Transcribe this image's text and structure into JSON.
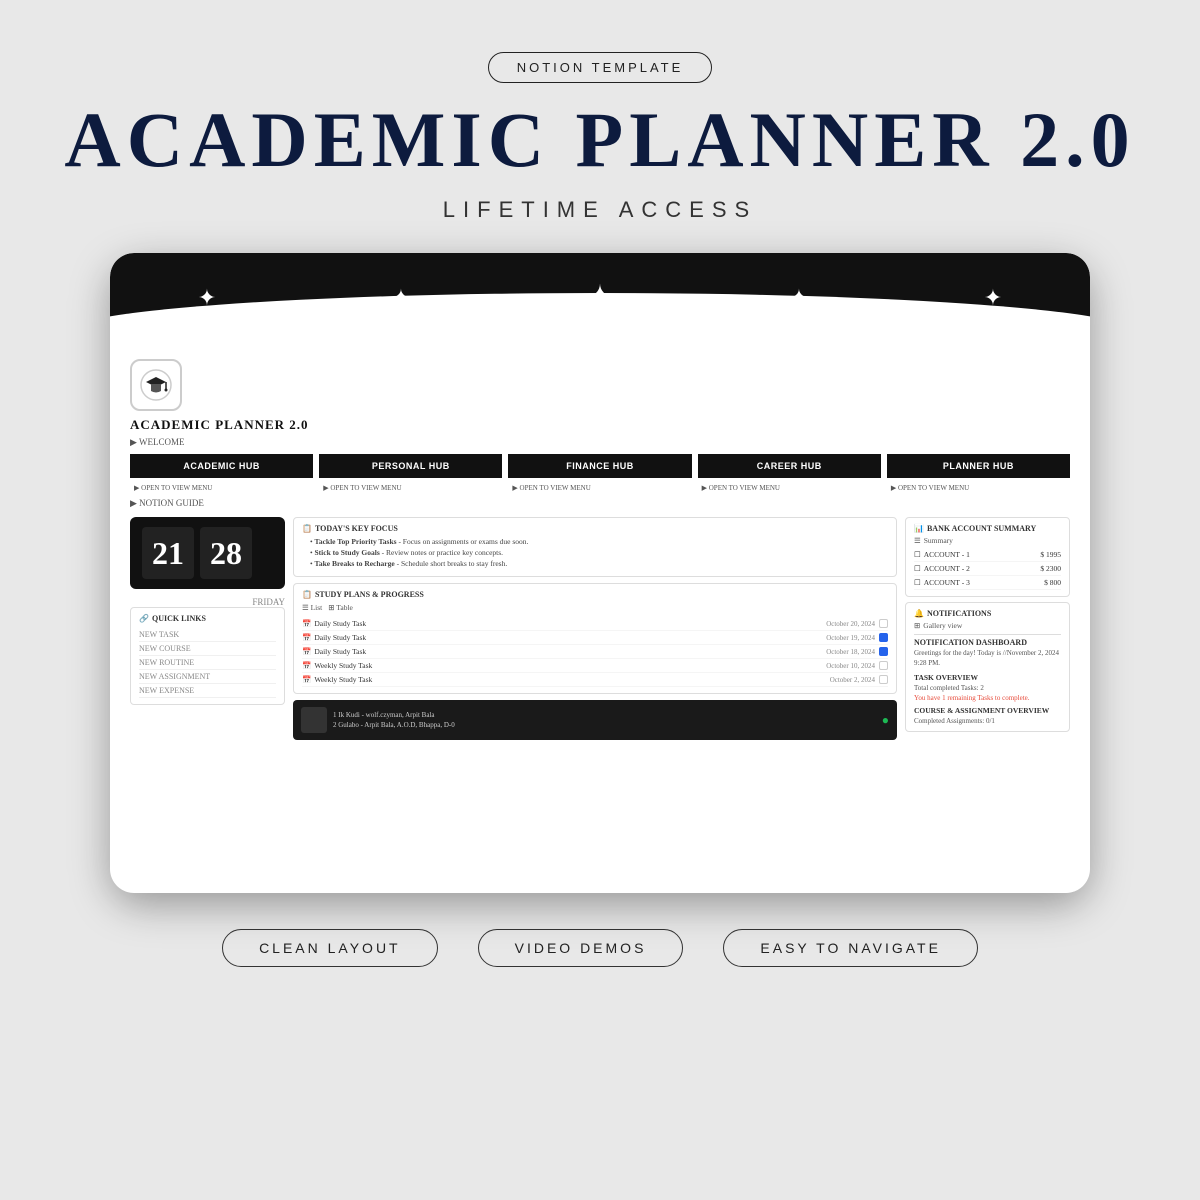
{
  "top_badge": "NOTION TEMPLATE",
  "main_title": "ACADEMIC PLANNER 2.0",
  "subtitle": "LIFETIME ACCESS",
  "device": {
    "stars": [
      "✦",
      "✦",
      "✦",
      "✦"
    ],
    "large_star": "✦",
    "notion_page_title": "ACADEMIC PLANNER 2.0",
    "welcome_label": "▶ WELCOME",
    "hub_buttons": [
      {
        "label": "ACADEMIC HUB"
      },
      {
        "label": "PERSONAL HUB"
      },
      {
        "label": "FINANCE HUB"
      },
      {
        "label": "CAREER HUB"
      },
      {
        "label": "PLANNER HUB"
      }
    ],
    "open_menu_label": "▶ OPEN TO VIEW MENU",
    "notion_guide_label": "▶ NOTION GUIDE",
    "clock": {
      "hour": "21",
      "minute": "28",
      "day": "FRIDAY"
    },
    "quick_links": {
      "title": "QUICK LINKS",
      "items": [
        "NEW TASK",
        "NEW COURSE",
        "NEW ROUTINE",
        "NEW ASSIGNMENT",
        "NEW EXPENSE"
      ]
    },
    "focus": {
      "title": "TODAY'S KEY FOCUS",
      "items": [
        {
          "bold": "Tackle Top Priority Tasks",
          "text": " - Focus on assignments or exams due soon."
        },
        {
          "bold": "Stick to Study Goals",
          "text": " - Review notes or practice key concepts."
        },
        {
          "bold": "Take Breaks to Recharge",
          "text": " - Schedule short breaks to stay fresh."
        }
      ]
    },
    "study_plans": {
      "title": "STUDY PLANS & PROGRESS",
      "views": [
        "List",
        "Table"
      ],
      "tasks": [
        {
          "icon": "📅",
          "name": "Daily Study Task",
          "date": "October 20, 2024",
          "checked": false
        },
        {
          "icon": "📅",
          "name": "Daily Study Task",
          "date": "October 19, 2024",
          "checked": true
        },
        {
          "icon": "📅",
          "name": "Daily Study Task",
          "date": "October 18, 2024",
          "checked": true
        },
        {
          "icon": "📅",
          "name": "Weekly Study Task",
          "date": "October 10, 2024",
          "checked": false
        },
        {
          "icon": "📅",
          "name": "Weekly Study Task",
          "date": "October 2, 2024",
          "checked": false
        }
      ]
    },
    "music": {
      "tracks": [
        "1   Ik Kudi - wolf.czyman, Arpit Bala",
        "2   Gulabo - Arpit Bala, A.O.D, Bhappa, D-0"
      ]
    },
    "bank": {
      "title": "BANK ACCOUNT SUMMARY",
      "summary_label": "Summary",
      "accounts": [
        {
          "name": "ACCOUNT - 1",
          "amount": "$ 1995"
        },
        {
          "name": "ACCOUNT - 2",
          "amount": "$ 2300"
        },
        {
          "name": "ACCOUNT - 3",
          "amount": "$ 800"
        }
      ]
    },
    "notifications": {
      "title": "NOTIFICATIONS",
      "gallery_label": "Gallery view",
      "dashboard_title": "NOTIFICATION DASHBOARD",
      "greeting": "Greetings for the day! Today is //November 2, 2024 9:28 PM.",
      "task_overview_title": "TASK OVERVIEW",
      "total_tasks": "Total completed Tasks: 2",
      "remaining_tasks": "You have 1 remaining Tasks to complete.",
      "course_overview_title": "COURSE & ASSIGNMENT OVERVIEW",
      "completed_assignments": "Completed Assignments: 0/1"
    }
  },
  "bottom_badges": [
    "CLEAN LAYOUT",
    "VIDEO DEMOS",
    "EASY TO NAVIGATE"
  ]
}
